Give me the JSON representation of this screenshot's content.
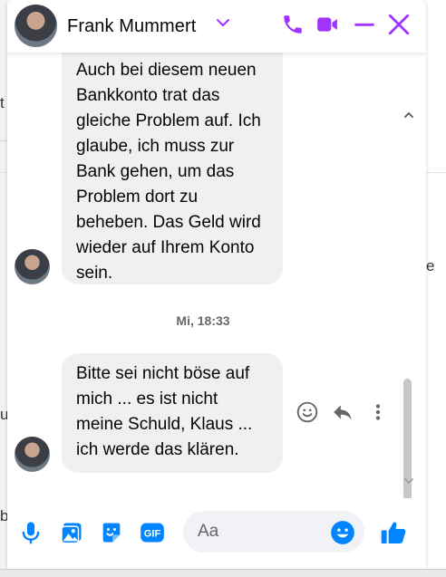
{
  "theme": {
    "accent": "#a033ff",
    "blue": "#0084ff",
    "bubble": "#f0f0f0"
  },
  "background": {
    "chars": [
      "t",
      "e",
      "u",
      "b"
    ]
  },
  "header": {
    "contact_name": "Frank Mummert",
    "icons": [
      "chevron-down-icon",
      "phone-icon",
      "video-icon",
      "minimize-icon",
      "close-icon"
    ]
  },
  "messages": {
    "incoming_1": "Auch bei diesem neuen Bankkonto trat das gleiche Problem auf. Ich glaube, ich muss zur Bank gehen, um das Problem dort zu beheben. Das Geld wird wieder auf Ihrem Konto sein.",
    "timestamp": "Mi, 18:33",
    "incoming_2": "Bitte sei nicht böse auf mich ... es ist nicht meine Schuld, Klaus ... ich werde das klären."
  },
  "composer": {
    "placeholder": "Aa",
    "icons": [
      "microphone-icon",
      "photo-icon",
      "sticker-icon",
      "gif-icon",
      "emoji-icon",
      "thumbs-up-icon"
    ]
  }
}
